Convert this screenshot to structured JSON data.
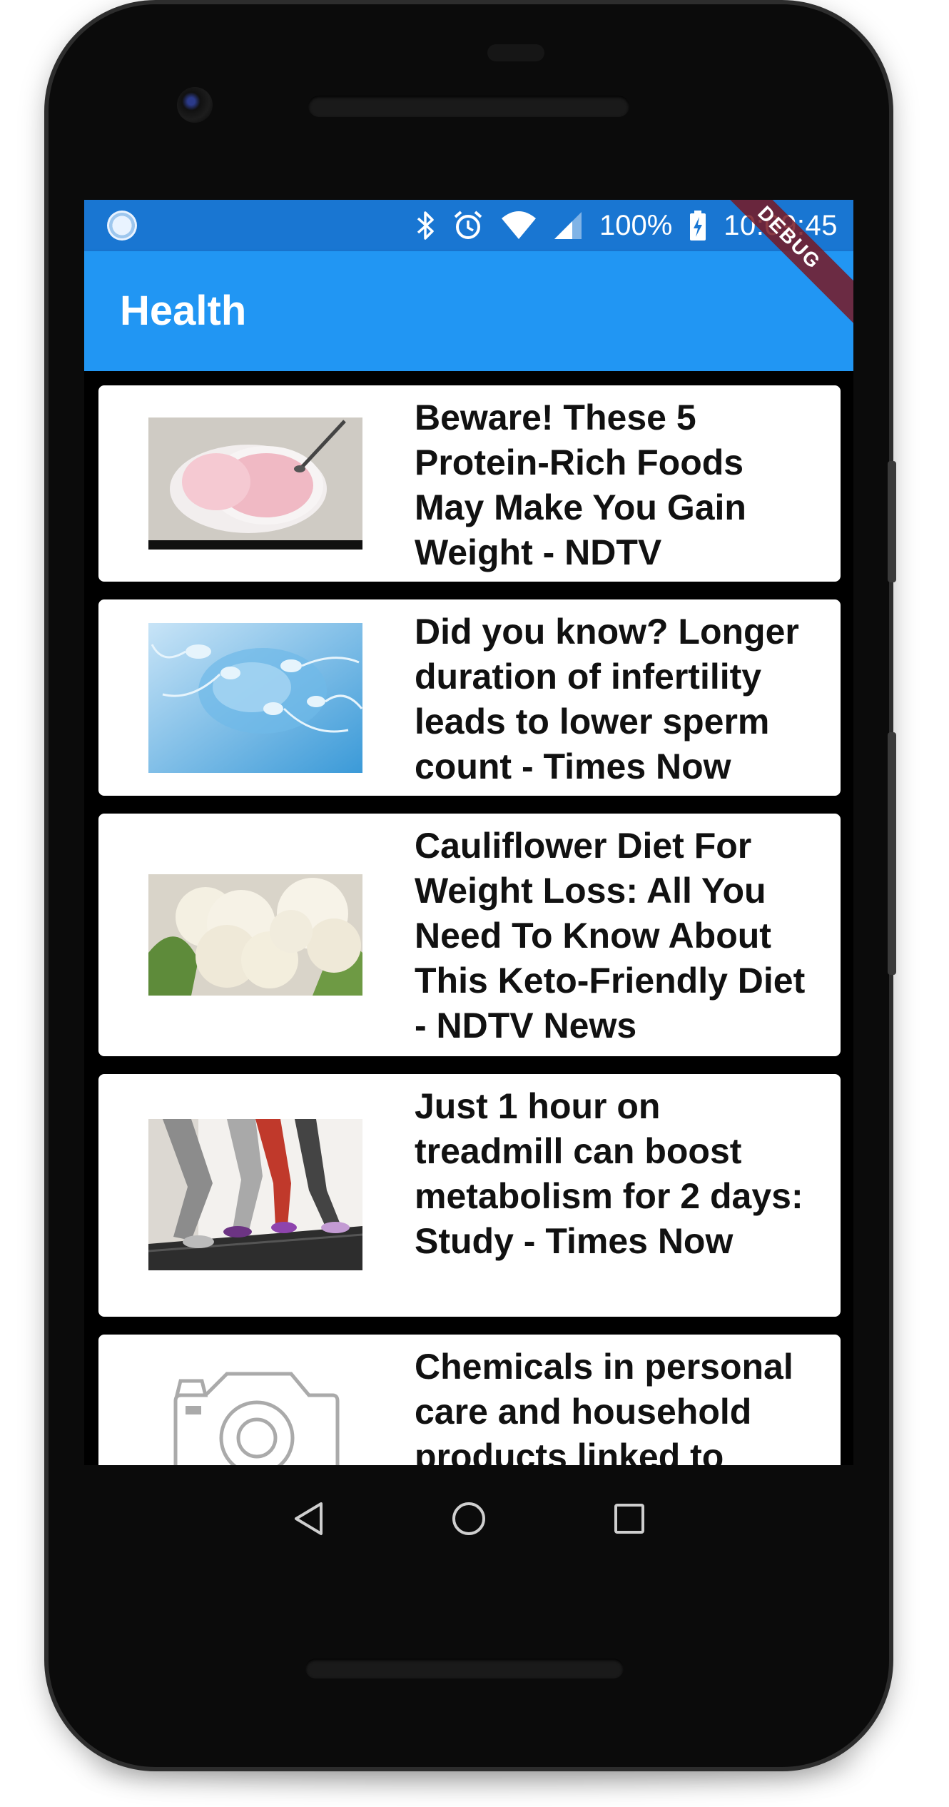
{
  "status_bar": {
    "battery": "100%",
    "time": "10:09:45",
    "icons": [
      "data-saver-icon",
      "bluetooth-icon",
      "alarm-icon",
      "wifi-icon",
      "cell-signal-icon",
      "battery-charging-icon"
    ]
  },
  "debug_banner": "DEBUG",
  "app_bar": {
    "title": "Health"
  },
  "articles": [
    {
      "title": "Beware! These 5 Protein-Rich Foods May Make You Gain Weight - NDTV",
      "image": "yogurt-cup-photo"
    },
    {
      "title": "Did you know? Longer duration of infertility leads to lower sperm count - Times Now",
      "image": "sperm-cells-photo"
    },
    {
      "title": "Cauliflower Diet For Weight Loss: All You Need To Know About This Keto-Friendly Diet - NDTV News",
      "image": "cauliflower-photo"
    },
    {
      "title": "Just 1 hour on treadmill can boost metabolism for 2 days: Study - Times Now",
      "image": "treadmill-runners-photo"
    },
    {
      "title": "Chemicals in personal care and household products linked to",
      "image": "camera-placeholder-icon"
    }
  ],
  "nav_bar": {
    "buttons": [
      "back-icon",
      "home-icon",
      "recents-icon"
    ]
  },
  "colors": {
    "status_bar": "#1976d2",
    "app_bar": "#2196f3",
    "card": "#ffffff",
    "background": "#000000"
  }
}
